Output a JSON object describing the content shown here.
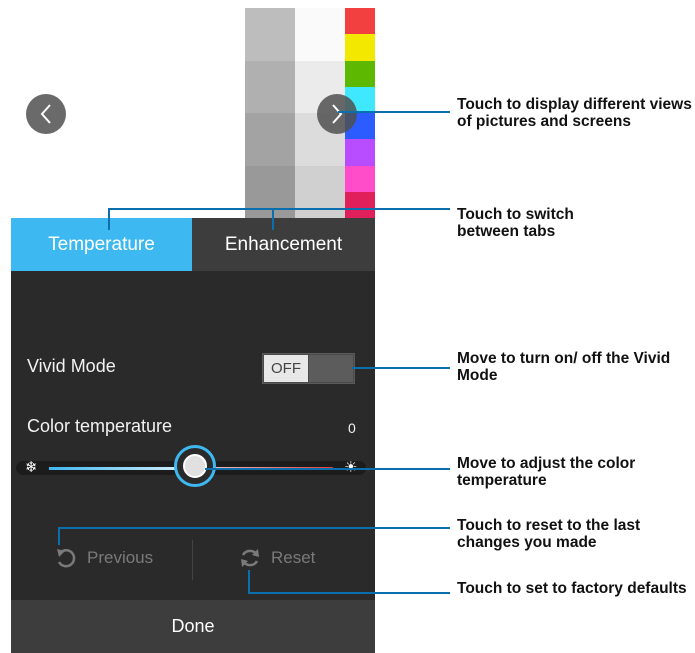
{
  "colors": {
    "accent": "#3eb8f0",
    "callout_line": "#0b6fad",
    "panel_bg": "#2a2a2a",
    "tab_inactive": "#3d3d3d"
  },
  "preview": {
    "gray_column_a": [
      "#bdbdbd",
      "#b0b0b0",
      "#a3a3a3",
      "#999999"
    ],
    "gray_column_b": [
      "#fafafa",
      "#ebebeb",
      "#dcdcdc",
      "#d0d0d0"
    ],
    "color_column": [
      "#f24040",
      "#f2e800",
      "#5cb800",
      "#40e8ff",
      "#2a5cff",
      "#b84cff",
      "#ff4cc8",
      "#e0205a"
    ],
    "left_arrow_icon": "chevron-left-icon",
    "right_arrow_icon": "chevron-right-icon"
  },
  "tabs": {
    "temperature": "Temperature",
    "enhancement": "Enhancement"
  },
  "vivid_mode": {
    "label": "Vivid Mode",
    "toggle_state": "OFF"
  },
  "color_temperature": {
    "label": "Color temperature",
    "value": "0",
    "slider_position": 0.5,
    "cold_icon": "snowflake-icon",
    "warm_icon": "sun-icon"
  },
  "actions": {
    "previous": "Previous",
    "reset": "Reset",
    "done": "Done"
  },
  "callouts": {
    "views": "Touch to display different views of pictures and screens",
    "tabs": "Touch to switch between tabs",
    "vivid": "Move to turn on/ off the Vivid Mode",
    "temperature": "Move to adjust the color temperature",
    "previous": "Touch to reset to the last changes you made",
    "reset": "Touch to set to factory defaults"
  }
}
